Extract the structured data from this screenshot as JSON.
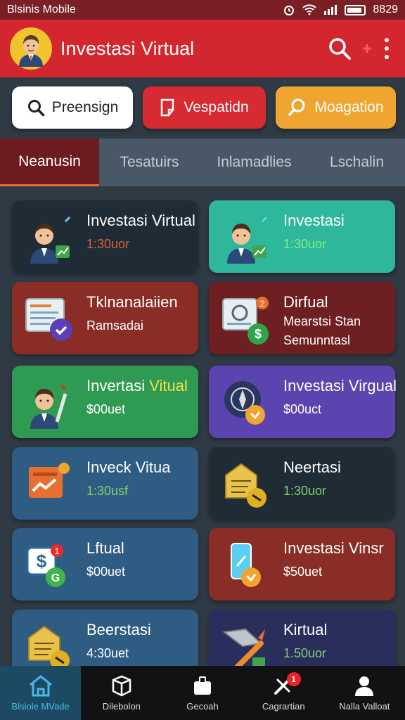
{
  "status_bar": {
    "carrier": "Blsinis Mobile",
    "time": "8829"
  },
  "app_bar": {
    "title": "Investasi Virtual"
  },
  "action_buttons": [
    {
      "label": "Preensign",
      "icon": "search-icon"
    },
    {
      "label": "Vespatidn",
      "icon": "document-icon"
    },
    {
      "label": "Moagation",
      "icon": "search-icon"
    }
  ],
  "tabs": [
    {
      "label": "Neanusin",
      "active": true
    },
    {
      "label": "Tesatuirs",
      "active": false
    },
    {
      "label": "Inlamadlies",
      "active": false
    },
    {
      "label": "Lschalin",
      "active": false
    }
  ],
  "cards": [
    {
      "title": "Investasi Virtual",
      "subtitle": "1:30uor",
      "bg": "#1f2c36",
      "title_color": "#ffffff",
      "subtitle_color": "#e05a3a",
      "icon": "businessman-chart-icon"
    },
    {
      "title": "Investasi",
      "subtitle": "1:30uor",
      "bg": "#2fb79c",
      "title_color": "#ffffff",
      "subtitle_color": "#7ff07a",
      "icon": "businessman-chart-icon"
    },
    {
      "title": "Tklnanalaiien",
      "subtitle": "Ramsadai",
      "bg": "#8a2d26",
      "title_color": "#ffffff",
      "subtitle_color": "#ffffff",
      "icon": "report-check-icon"
    },
    {
      "title": "Dirfual",
      "subtitle": "Mearstsi Stan",
      "subtitle2": "Semunntasl",
      "bg": "#6e1f22",
      "title_color": "#ffffff",
      "subtitle_color": "#ffffff",
      "icon": "report-dollar-icon"
    },
    {
      "title": "Invertasi Vitual",
      "subtitle": "$00uet",
      "bg": "#2f9a52",
      "title_color": "#ffffff",
      "title_accent": "Vitual",
      "subtitle_color": "#ffffff",
      "icon": "businessman-pen-icon"
    },
    {
      "title": "Investasi Virgual",
      "subtitle": "$00uct",
      "bg": "#5a45b0",
      "title_color": "#ffffff",
      "subtitle_color": "#ffffff",
      "icon": "compass-icon"
    },
    {
      "title": "Inveck Vitua",
      "subtitle": "1:30usf",
      "bg": "#2f5c82",
      "title_color": "#ffffff",
      "subtitle_color": "#7ed071",
      "icon": "trend-chart-icon"
    },
    {
      "title": "Neertasi",
      "subtitle": "1:30uor",
      "bg": "#1f2c36",
      "title_color": "#ffffff",
      "subtitle_color": "#7ed071",
      "icon": "box-tag-icon"
    },
    {
      "title": "Lftual",
      "subtitle": "$00uet",
      "bg": "#2f5c82",
      "title_color": "#ffffff",
      "subtitle_color": "#ffffff",
      "icon": "dollar-card-icon"
    },
    {
      "title": "Investasi Vinsr",
      "subtitle": "$50uet",
      "bg": "#8a2d26",
      "title_color": "#ffffff",
      "subtitle_color": "#ffffff",
      "icon": "phone-icon"
    },
    {
      "title": "Beerstasi",
      "subtitle": "4:30uet",
      "bg": "#2f5c82",
      "title_color": "#ffffff",
      "subtitle_color": "#ffffff",
      "icon": "box-tag-icon"
    },
    {
      "title": "Kirtual",
      "subtitle": "1.50uor",
      "bg": "#2a2e5c",
      "title_color": "#ffffff",
      "subtitle_color": "#7ed071",
      "icon": "rocket-icon"
    }
  ],
  "bottom_nav": [
    {
      "label": "Blsiole MVade",
      "icon": "home-icon",
      "active": true
    },
    {
      "label": "Dilebolon",
      "icon": "box-icon",
      "active": false
    },
    {
      "label": "Gecoah",
      "icon": "wallet-icon",
      "active": false
    },
    {
      "label": "Cagrartian",
      "icon": "tools-icon",
      "active": false,
      "badge": "1"
    },
    {
      "label": "Nalla Valloat",
      "icon": "user-icon",
      "active": false
    }
  ]
}
